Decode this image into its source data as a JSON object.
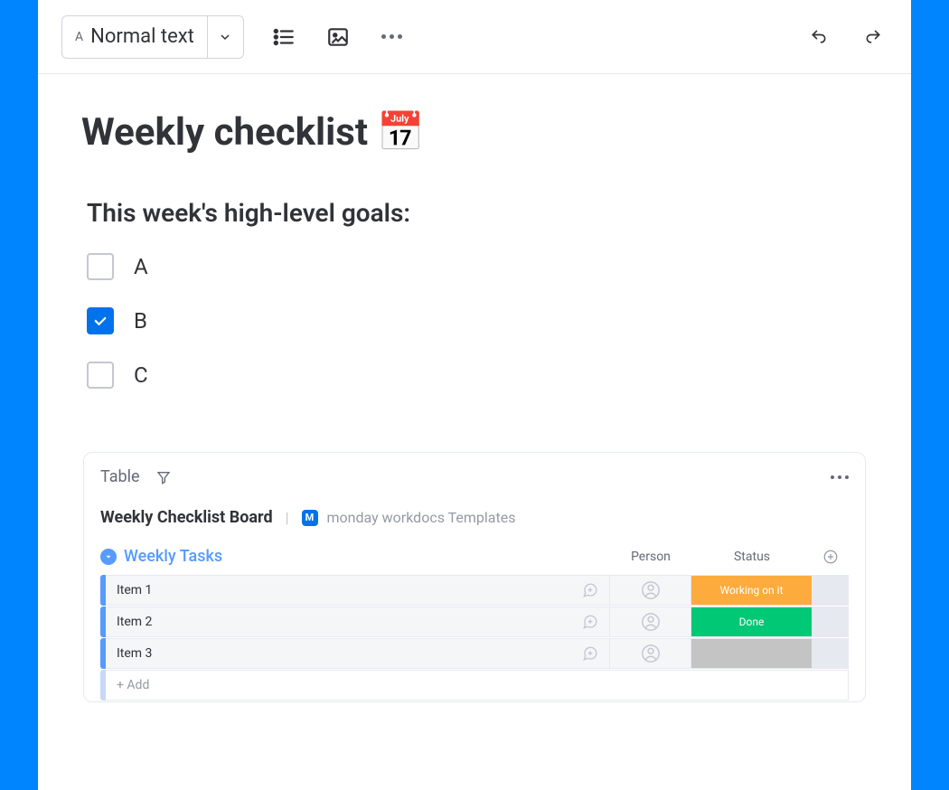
{
  "toolbar": {
    "text_style": "Normal text"
  },
  "doc": {
    "title": "Weekly checklist",
    "title_emoji": "📅",
    "section_heading": "This week's high-level goals:",
    "checklist": [
      {
        "label": "A",
        "checked": false
      },
      {
        "label": "B",
        "checked": true
      },
      {
        "label": "C",
        "checked": false
      }
    ]
  },
  "board": {
    "view_tab": "Table",
    "title": "Weekly Checklist Board",
    "workspace_badge": "M",
    "workspace_name": "monday workdocs Templates",
    "group_name": "Weekly Tasks",
    "columns": {
      "person": "Person",
      "status": "Status"
    },
    "rows": [
      {
        "name": "Item 1",
        "status_label": "Working on it",
        "status_class": "status-working"
      },
      {
        "name": "Item 2",
        "status_label": "Done",
        "status_class": "status-done"
      },
      {
        "name": "Item 3",
        "status_label": "",
        "status_class": "status-empty"
      }
    ],
    "add_row_label": "+ Add"
  }
}
